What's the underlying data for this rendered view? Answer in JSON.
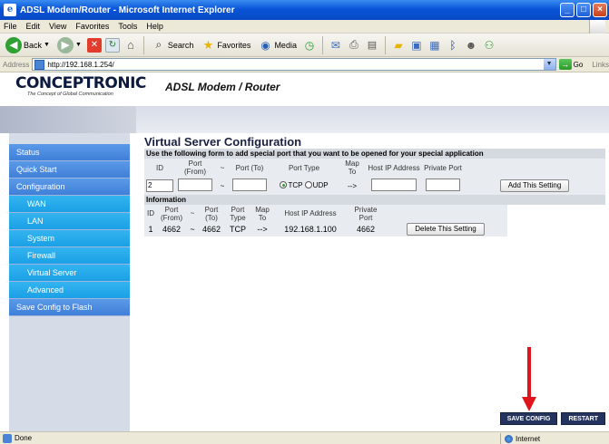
{
  "window": {
    "title": "ADSL Modem/Router - Microsoft Internet Explorer"
  },
  "menu": [
    "File",
    "Edit",
    "View",
    "Favorites",
    "Tools",
    "Help"
  ],
  "toolbar": {
    "back": "Back",
    "search": "Search",
    "favorites": "Favorites",
    "media": "Media"
  },
  "address": {
    "label": "Address",
    "url": "http://192.168.1.254/",
    "go": "Go",
    "links": "Links"
  },
  "header": {
    "logo": "CONCEPTRONIC",
    "tagline": "The Concept of Global Communication",
    "product": "ADSL Modem / Router"
  },
  "sidebar": {
    "items": [
      {
        "label": "Status",
        "sub": false
      },
      {
        "label": "Quick Start",
        "sub": false
      },
      {
        "label": "Configuration",
        "sub": false
      },
      {
        "label": "WAN",
        "sub": true
      },
      {
        "label": "LAN",
        "sub": true
      },
      {
        "label": "System",
        "sub": true
      },
      {
        "label": "Firewall",
        "sub": true
      },
      {
        "label": "Virtual Server",
        "sub": true
      },
      {
        "label": "Advanced",
        "sub": true
      },
      {
        "label": "Save Config to Flash",
        "sub": false
      }
    ]
  },
  "main": {
    "title": "Virtual Server Configuration",
    "hint": "Use the following form to add special port that you want to be opened for your special application",
    "form": {
      "headers": {
        "id": "ID",
        "port_from": "Port (From)",
        "tilde": "~",
        "port_to": "Port (To)",
        "port_type": "Port Type",
        "map_to": "Map To",
        "host_ip": "Host IP Address",
        "private_port": "Private Port"
      },
      "id_value": "2",
      "port_from_value": "",
      "port_to_value": "",
      "tcp_label": "TCP",
      "udp_label": "UDP",
      "arrow": "-->",
      "host_ip_value": "",
      "private_port_value": "",
      "add_button": "Add This Setting"
    },
    "info": {
      "title": "Information",
      "headers": {
        "id": "ID",
        "port_from": "Port (From)",
        "tilde": "~",
        "port_to": "Port (To)",
        "port_type": "Port Type",
        "map_to": "Map To",
        "host_ip": "Host IP Address",
        "private_port": "Private Port"
      },
      "row": {
        "id": "1",
        "port_from": "4662",
        "tilde": "~",
        "port_to": "4662",
        "type": "TCP",
        "arrow": "-->",
        "host_ip": "192.168.1.100",
        "private_port": "4662",
        "delete_button": "Delete This Setting"
      }
    }
  },
  "buttons": {
    "save_config": "SAVE CONFIG",
    "restart": "RESTART"
  },
  "status": {
    "text": "Done",
    "zone": "Internet"
  },
  "colors": {
    "sidebar_main": "#4a8ae0",
    "sidebar_sub": "#22a8ea",
    "button_dark": "#24345e",
    "annotation_arrow": "#e0141c"
  }
}
